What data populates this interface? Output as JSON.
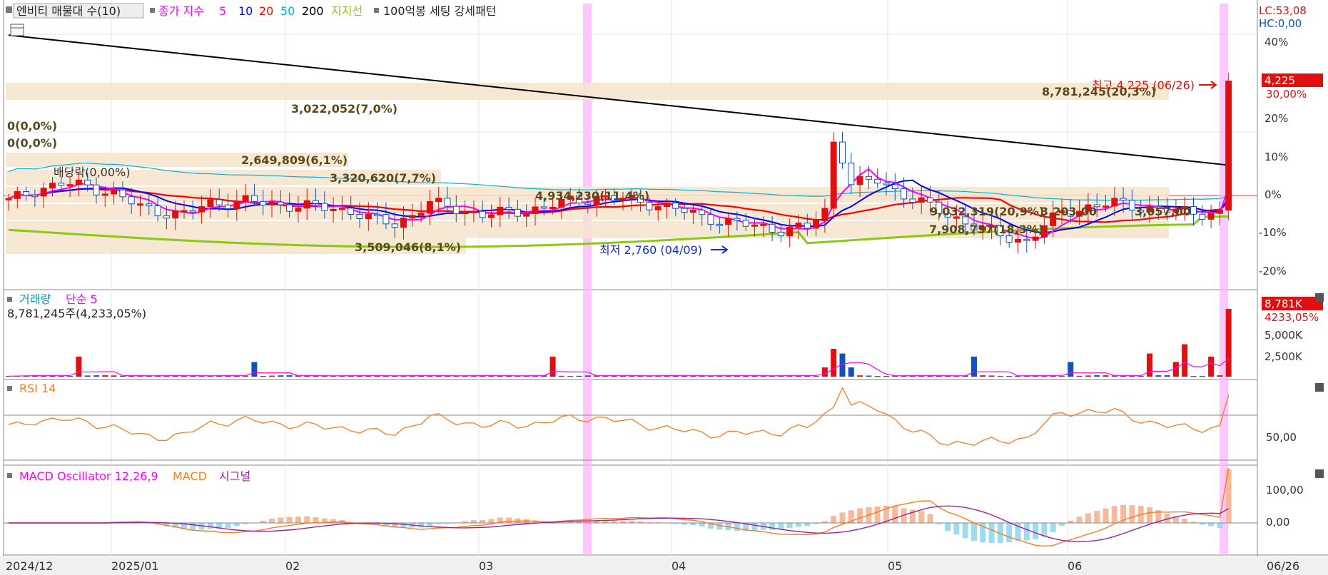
{
  "legend_main": {
    "icon": "square-icon",
    "title": "엔비티 매물대 수(10)",
    "close_label": "종가 지수",
    "ma_5": "5",
    "ma_10": "10",
    "ma_20": "20",
    "ma_50": "50",
    "ma_200": "200",
    "support_label": "지지선",
    "pattern_label": "100억봉 세팅 강세패턴"
  },
  "readout": {
    "lc": "LC:53,08",
    "hc": "HC:0,00"
  },
  "colors": {
    "ma5": "#ff00ff",
    "ma10": "#0000ff",
    "ma20": "#ff0000",
    "ma50": "#00b4dc",
    "ma200": "#000000",
    "support": "#8cc814",
    "band": "#f6e4cc",
    "highlight": "#ffb4ff",
    "up": "#e01010",
    "down": "#1050c0",
    "rsi": "#ff7a1a",
    "macd": "#ff7a1a",
    "signal": "#a020a0"
  },
  "price_axis": [
    "40%",
    "30,00%",
    "20%",
    "10%",
    "0%",
    "-10%",
    "-20%"
  ],
  "price_marker": "4,225",
  "annotations": {
    "high": "최고 4,225 (06/26)",
    "low": "최저 2,760 (04/09)",
    "ex_div": "배당락(0,00%)",
    "zero1": "0(0,0%)",
    "zero2": "0(0,0%)"
  },
  "volume_profile": [
    {
      "label": "8,781,245(20,3%)"
    },
    {
      "label": "3,022,052(7,0%)"
    },
    {
      "label": "2,649,809(6,1%)"
    },
    {
      "label": "3,320,620(7,7%)"
    },
    {
      "label": "4,934,230(11,4%)"
    },
    {
      "label": "9,032,319(20,9%)"
    },
    {
      "label": "3,203,00"
    },
    {
      "label": "3,057,00"
    },
    {
      "label": "7,908,757(18,3%)"
    },
    {
      "label": "3,509,046(8,1%)"
    }
  ],
  "volume_panel": {
    "title": "거래량",
    "ma_label": "단순 5",
    "value": "8,781,245주(4,233,05%)",
    "marker": "8,781K",
    "marker_pct": "4233,05%",
    "axis": [
      "5,000K",
      "2,500K"
    ]
  },
  "rsi_panel": {
    "title": "RSI 14",
    "axis": [
      "50,00"
    ]
  },
  "macd_panel": {
    "title": "MACD Oscillator 12,26,9",
    "macd_label": "MACD",
    "signal_label": "시그널",
    "axis": [
      "100,00",
      "0,00"
    ]
  },
  "x_labels": [
    "2024/12",
    "2025/01",
    "02",
    "03",
    "04",
    "05",
    "06",
    "06/26"
  ],
  "chart_data": {
    "type": "candlestick",
    "n_bars": 140,
    "y_range_pct": [
      -23,
      45
    ],
    "series": [
      {
        "name": "5",
        "kind": "ma"
      },
      {
        "name": "10",
        "kind": "ma"
      },
      {
        "name": "20",
        "kind": "ma"
      },
      {
        "name": "50",
        "kind": "ma"
      },
      {
        "name": "200",
        "kind": "ma"
      },
      {
        "name": "지지선",
        "kind": "support"
      }
    ],
    "close_keypoints": [
      [
        0,
        -1.5
      ],
      [
        3,
        1.5
      ],
      [
        6,
        3
      ],
      [
        9,
        2.5
      ],
      [
        12,
        0.5
      ],
      [
        15,
        -3
      ],
      [
        18,
        -4.5
      ],
      [
        20,
        -5
      ],
      [
        23,
        -2
      ],
      [
        27,
        -1.5
      ],
      [
        31,
        -2.5
      ],
      [
        35,
        -3
      ],
      [
        39,
        -4
      ],
      [
        41,
        -6
      ],
      [
        44,
        -7.5
      ],
      [
        46,
        -5
      ],
      [
        48,
        -2
      ],
      [
        51,
        -3.5
      ],
      [
        54,
        -5
      ],
      [
        57,
        -4.5
      ],
      [
        60,
        -3.5
      ],
      [
        62,
        -2.5
      ],
      [
        64,
        -1.5
      ],
      [
        67,
        -0.5
      ],
      [
        70,
        -1
      ],
      [
        73,
        -2
      ],
      [
        76,
        -3.5
      ],
      [
        79,
        -5.5
      ],
      [
        82,
        -7
      ],
      [
        85,
        -8
      ],
      [
        88,
        -9
      ],
      [
        91,
        -8.5
      ],
      [
        93,
        -4
      ],
      [
        94,
        14
      ],
      [
        96,
        3
      ],
      [
        99,
        4
      ],
      [
        101,
        1.5
      ],
      [
        103,
        -1
      ],
      [
        105,
        -3
      ],
      [
        108,
        -6
      ],
      [
        111,
        -9
      ],
      [
        114,
        -11
      ],
      [
        116,
        -12
      ],
      [
        118,
        -8
      ],
      [
        120,
        -4.5
      ],
      [
        123,
        -3
      ],
      [
        126,
        -2
      ],
      [
        129,
        -3
      ],
      [
        132,
        -4
      ],
      [
        136,
        -4.5
      ],
      [
        139,
        -5
      ]
    ],
    "volume_max_k": 8781,
    "rsi_range": [
      0,
      100
    ],
    "macd_range": [
      -80,
      130
    ]
  }
}
